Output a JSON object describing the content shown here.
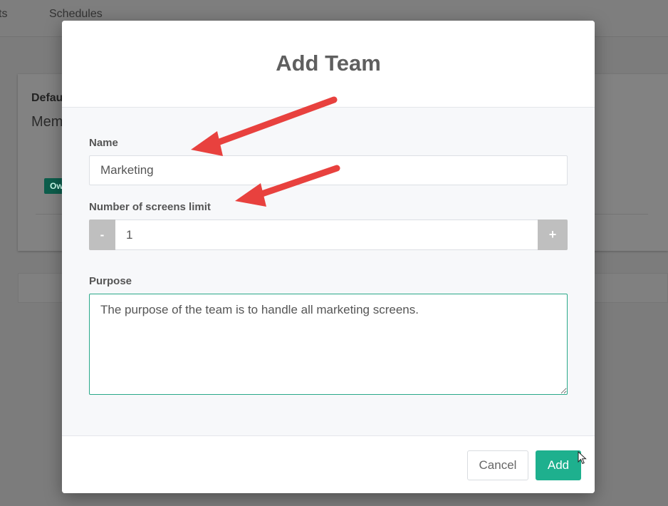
{
  "background": {
    "nav": {
      "item_partial": "ts",
      "item_schedules": "Schedules"
    },
    "card": {
      "title_partial": "Defau",
      "subtitle_partial": "Mem",
      "badge_partial": "Ow"
    }
  },
  "modal": {
    "title": "Add Team",
    "name": {
      "label": "Name",
      "value": "Marketing"
    },
    "screens_limit": {
      "label": "Number of screens limit",
      "value": "1",
      "decrement_label": "-",
      "increment_label": "+"
    },
    "purpose": {
      "label": "Purpose",
      "value": "The purpose of the team is to handle all marketing screens."
    },
    "footer": {
      "cancel_label": "Cancel",
      "add_label": "Add"
    }
  },
  "colors": {
    "accent": "#1eb08e",
    "annotation_arrow": "#e8413e",
    "focus_border": "#2aa889"
  }
}
